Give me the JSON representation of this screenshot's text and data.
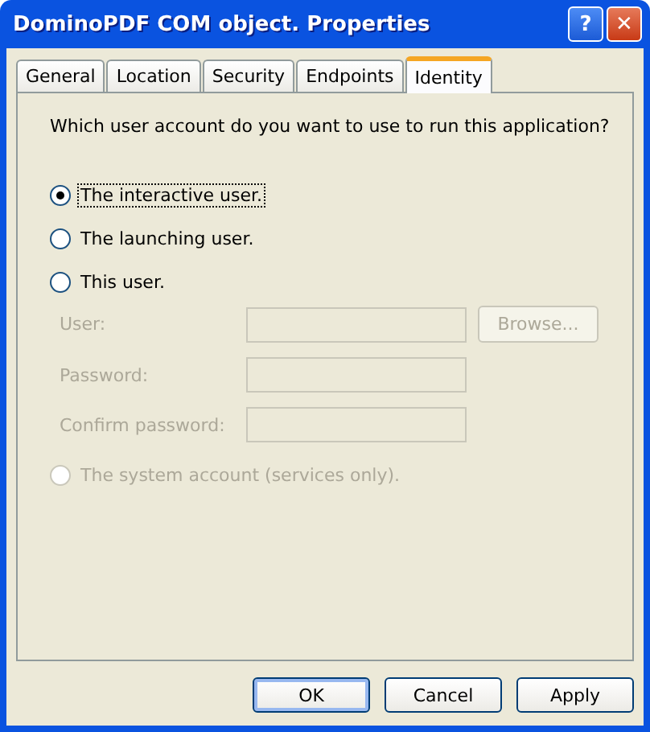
{
  "window": {
    "title": "DominoPDF COM object. Properties",
    "title_buttons": [
      "?",
      "✕"
    ]
  },
  "tabs": [
    {
      "label": "General",
      "selected": false
    },
    {
      "label": "Location",
      "selected": false
    },
    {
      "label": "Security",
      "selected": false
    },
    {
      "label": "Endpoints",
      "selected": false
    },
    {
      "label": "Identity",
      "selected": true
    }
  ],
  "question": "Which user account do you want to use to run this application?",
  "options": [
    {
      "label": "The interactive user.",
      "selected": true,
      "disabled": false,
      "focused": true
    },
    {
      "label": "The launching user.",
      "selected": false,
      "disabled": false,
      "focused": false
    },
    {
      "label": "This user.",
      "selected": false,
      "disabled": false,
      "focused": false,
      "fields": [
        {
          "label": "User:",
          "disabled": true,
          "button": "Browse..."
        },
        {
          "label": "Password:",
          "disabled": true
        },
        {
          "label": "Confirm password:",
          "disabled": true
        }
      ]
    },
    {
      "label": "The system account (services only).",
      "selected": false,
      "disabled": true,
      "focused": false
    }
  ],
  "buttons": [
    {
      "label": "OK",
      "default": true
    },
    {
      "label": "Cancel",
      "default": false
    },
    {
      "label": "Apply",
      "default": false
    }
  ]
}
